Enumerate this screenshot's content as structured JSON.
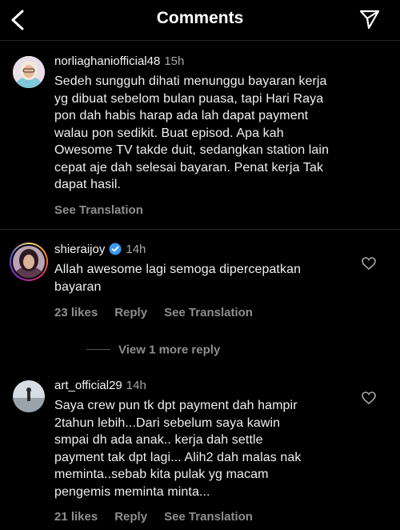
{
  "header": {
    "title": "Comments"
  },
  "comments": [
    {
      "username": "norliaghaniofficial48",
      "time": "15h",
      "lines": [
        "Sedeh sungguh dihati menunggu bayaran kerja",
        "yg dibuat sebelom bulan puasa, tapi Hari Raya",
        "pon dah habis harap ada lah dapat payment",
        "walau pon sedikit. Buat episod. Apa kah",
        "Owesome TV takde duit, sedangkan station lain",
        "cepat aje dah selesai bayaran. Penat kerja Tak",
        "dapat hasil."
      ],
      "see_translation": "See Translation"
    },
    {
      "username": "shieraijoy",
      "time": "14h",
      "lines": [
        "Allah awesome lagi semoga dipercepatkan",
        "bayaran"
      ],
      "likes": "23 likes",
      "reply": "Reply",
      "see_translation": "See Translation"
    },
    {
      "username": "art_official29",
      "time": "14h",
      "lines": [
        "Saya crew pun tk dpt payment dah hampir",
        "2tahun lebih...Dari sebelum saya kawin",
        "smpai dh ada anak.. kerja dah settle",
        "payment tak dpt lagi... Alih2 dah malas nak",
        "meminta..sebab kita pulak yg macam",
        "pengemis meminta minta..."
      ],
      "likes": "21 likes",
      "reply": "Reply",
      "see_translation": "See Translation"
    }
  ],
  "view_more_replies": "View 1 more reply",
  "colors": {
    "background": "#000000",
    "text": "#f5f5f5",
    "muted": "#8e8e8e",
    "verified": "#3897f0"
  }
}
